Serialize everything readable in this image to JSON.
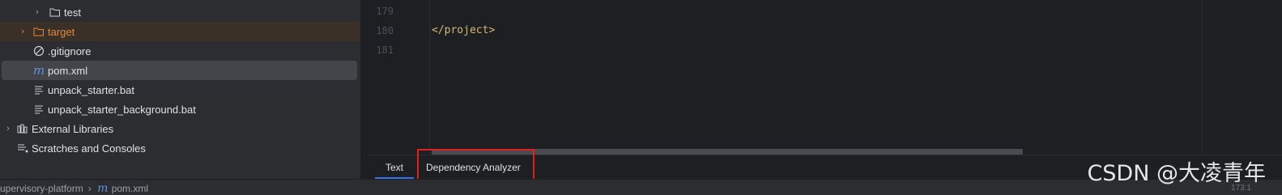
{
  "tree": {
    "items": [
      {
        "label": "test",
        "icon": "folder-icon"
      },
      {
        "label": "target",
        "icon": "folder-excluded-icon"
      },
      {
        "label": ".gitignore",
        "icon": "ignored-file-icon"
      },
      {
        "label": "pom.xml",
        "icon": "maven-icon"
      },
      {
        "label": "unpack_starter.bat",
        "icon": "text-file-icon"
      },
      {
        "label": "unpack_starter_background.bat",
        "icon": "text-file-icon"
      },
      {
        "label": "External Libraries",
        "icon": "libraries-icon"
      },
      {
        "label": "Scratches and Consoles",
        "icon": "scratches-icon"
      }
    ]
  },
  "editor": {
    "lines": [
      {
        "number": "179",
        "code": ""
      },
      {
        "number": "180",
        "code": "</project>"
      },
      {
        "number": "181",
        "code": ""
      }
    ],
    "tabs": [
      {
        "label": "Text",
        "active": true
      },
      {
        "label": "Dependency Analyzer",
        "active": false
      }
    ]
  },
  "status": {
    "project": "supervisory-platform",
    "file": "pom.xml",
    "caret": "173:1"
  },
  "watermark": "CSDN @大凌青年",
  "colors": {
    "accent": "#3574f0",
    "excluded": "#e0893a",
    "highlight_box": "#e0201c",
    "tag": "#d5b778"
  }
}
